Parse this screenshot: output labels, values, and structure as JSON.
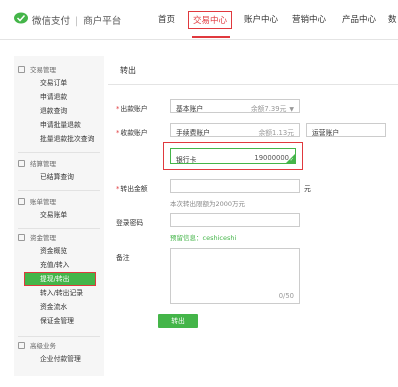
{
  "header": {
    "brand": "微信支付",
    "sub_brand": "商户平台",
    "nav": [
      {
        "label": "首页"
      },
      {
        "label": "交易中心"
      },
      {
        "label": "账户中心"
      },
      {
        "label": "营销中心"
      },
      {
        "label": "产品中心"
      },
      {
        "label": "数"
      }
    ],
    "active_nav": "交易中心"
  },
  "sidebar": {
    "groups": [
      {
        "title": "交易管理",
        "items": [
          "交易订单",
          "申请退款",
          "退款查询",
          "申请批量退款",
          "批量退款批次查询"
        ]
      },
      {
        "title": "结算管理",
        "items": [
          "已结算查询"
        ]
      },
      {
        "title": "账单管理",
        "items": [
          "交易账单"
        ]
      },
      {
        "title": "资金管理",
        "items": [
          "资金概览",
          "充值/转入",
          "提现/转出",
          "转入/转出记录",
          "资金流水",
          "保证金管理"
        ]
      },
      {
        "title": "高级业务",
        "items": [
          "企业付款管理"
        ]
      }
    ],
    "active_item": "提现/转出"
  },
  "form": {
    "title": "转出",
    "payer_label": "出款账户",
    "payer_value": "基本账户",
    "payer_balance": "余额7.39元",
    "payee_label": "收款账户",
    "payee_value": "手续费账户",
    "payee_balance": "余额1.13元",
    "payee_alt": "运营账户",
    "card_label": "银行卡",
    "card_number": "19000000",
    "amount_label": "转出金额",
    "amount_unit": "元",
    "amount_hint": "本次转出限额为2000万元",
    "password_label": "登录密码",
    "reserved_info": "预留信息：ceshiceshi",
    "remark_label": "备注",
    "remark_count": "0/50",
    "submit_label": "转出"
  },
  "colors": {
    "accent": "#44b549",
    "highlight": "#e0393e"
  }
}
